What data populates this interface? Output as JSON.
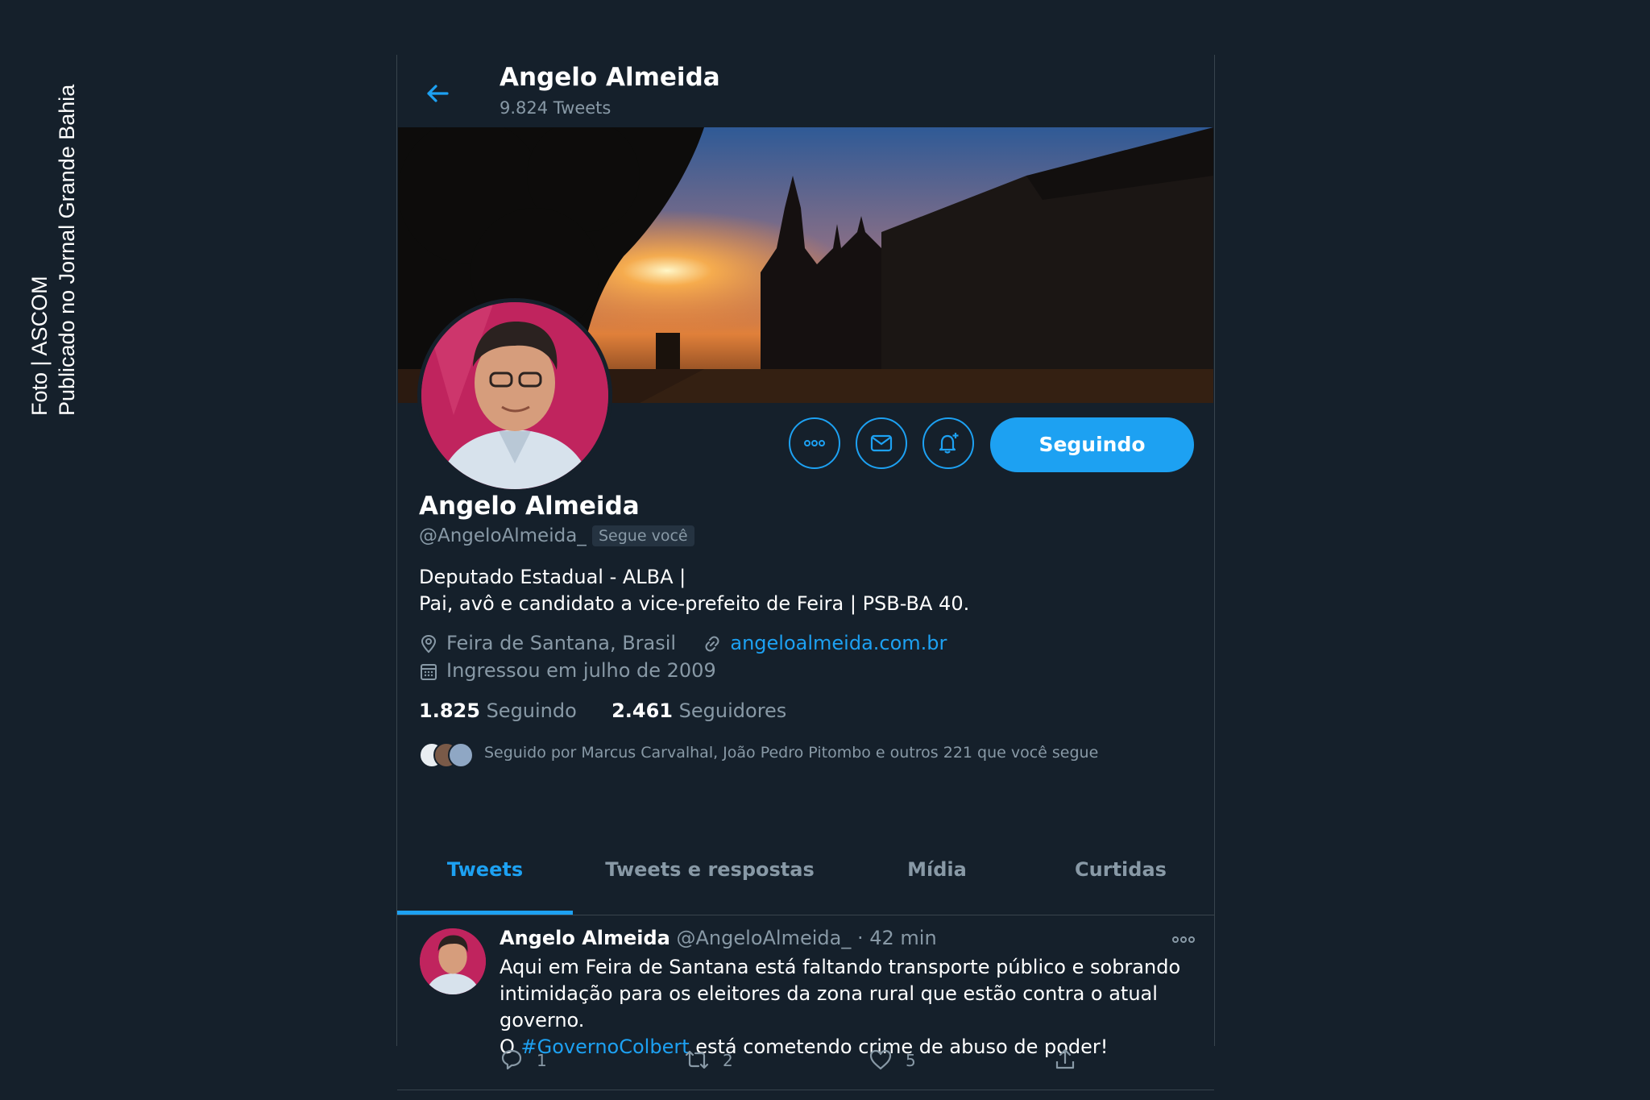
{
  "caption": {
    "line1": "Foto | ASCOM",
    "line2": "Publicado no Jornal Grande Bahia"
  },
  "header": {
    "back_icon": "arrow-left-icon",
    "name": "Angelo Almeida",
    "tweet_count": "9.824 Tweets"
  },
  "profile": {
    "name": "Angelo Almeida",
    "handle": "@AngeloAlmeida_",
    "follows_you": "Segue você",
    "bio_line1": "Deputado Estadual - ALBA |",
    "bio_line2": "Pai, avô e candidato a vice-prefeito de Feira | PSB-BA 40.",
    "location": "Feira de Santana, Brasil",
    "website": "angeloalmeida.com.br",
    "joined": "Ingressou em julho de 2009",
    "following_count": "1.825",
    "following_label": "Seguindo",
    "followers_count": "2.461",
    "followers_label": "Seguidores",
    "followed_by": "Seguido por Marcus Carvalhal, João Pedro Pitombo e outros 221 que você segue"
  },
  "actions": {
    "follow_label": "Seguindo",
    "more_icon": "more-dots-icon",
    "message_icon": "mail-icon",
    "notify_icon": "bell-plus-icon"
  },
  "tabs": [
    {
      "label": "Tweets",
      "active": true
    },
    {
      "label": "Tweets e respostas",
      "active": false
    },
    {
      "label": "Mídia",
      "active": false
    },
    {
      "label": "Curtidas",
      "active": false
    }
  ],
  "tweet": {
    "author": "Angelo Almeida",
    "handle_time": "@AngeloAlmeida_ · 42 min",
    "text_line1": "Aqui em Feira de Santana está faltando transporte público e sobrando",
    "text_line2": "intimidação para os eleitores da zona rural que estão contra o atual governo.",
    "text_line3_pre": "O ",
    "hashtag": "#GovernoColbert",
    "text_line3_post": " está cometendo crime de abuso de poder!",
    "replies": "1",
    "retweets": "2",
    "likes": "5"
  },
  "colors": {
    "background": "#15202b",
    "accent": "#1da1f2",
    "muted": "#8899a6",
    "border": "#38444d"
  }
}
